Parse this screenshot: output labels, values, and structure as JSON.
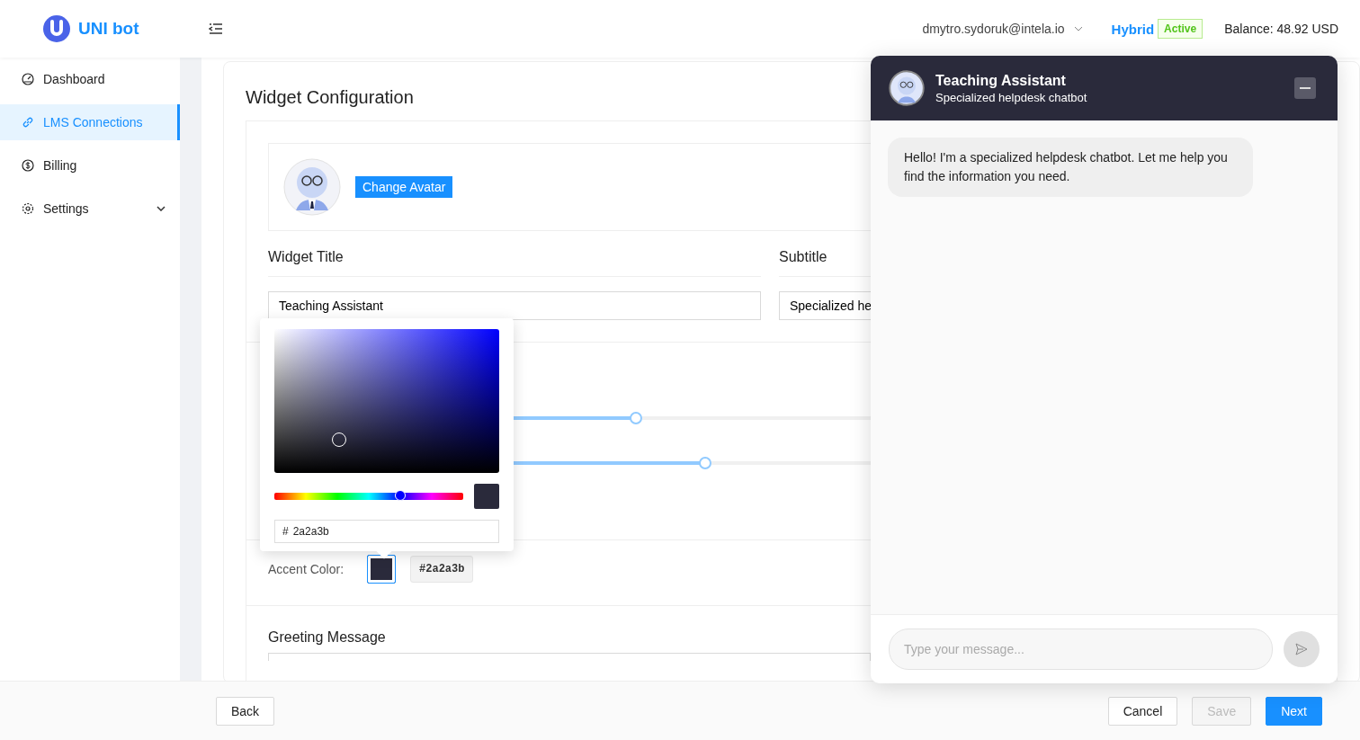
{
  "brand": {
    "name": "UNI bot"
  },
  "header": {
    "user": "dmytro.sydoruk@intela.io",
    "plan": "Hybrid",
    "plan_status": "Active",
    "balance": "Balance: 48.92 USD"
  },
  "sidebar": {
    "items": [
      {
        "label": "Dashboard",
        "selected": false,
        "has_submenu": false
      },
      {
        "label": "LMS Connections",
        "selected": true,
        "has_submenu": false
      },
      {
        "label": "Billing",
        "selected": false,
        "has_submenu": false
      },
      {
        "label": "Settings",
        "selected": false,
        "has_submenu": true
      }
    ]
  },
  "config": {
    "title": "Widget Configuration",
    "avatar_button": "Change Avatar",
    "widget_title_label": "Widget Title",
    "widget_title_value": "Teaching Assistant",
    "subtitle_label": "Subtitle",
    "subtitle_value": "Specialized he",
    "sliders": [
      {
        "level": 0.48
      },
      {
        "level": 0.57
      }
    ],
    "accent_label": "Accent Color:",
    "accent_hex": "#2a2a3b",
    "greeting_label": "Greeting Message"
  },
  "color_picker": {
    "hex_prefix": "#",
    "hex": "2a2a3b",
    "hue_slider": {
      "level": 0.667
    },
    "color": "#2a2a3b"
  },
  "chat": {
    "title": "Teaching Assistant",
    "subtitle": "Specialized helpdesk chatbot",
    "messages": [
      {
        "text": "Hello! I'm a specialized helpdesk chatbot. Let me help you find the information you need."
      }
    ],
    "input_placeholder": "Type your message..."
  },
  "footer": {
    "buttons": [
      {
        "label": "Back",
        "kind": "default"
      },
      {
        "label": "Cancel",
        "kind": "default"
      },
      {
        "label": "Save",
        "kind": "disabled"
      },
      {
        "label": "Next",
        "kind": "primary"
      }
    ]
  }
}
